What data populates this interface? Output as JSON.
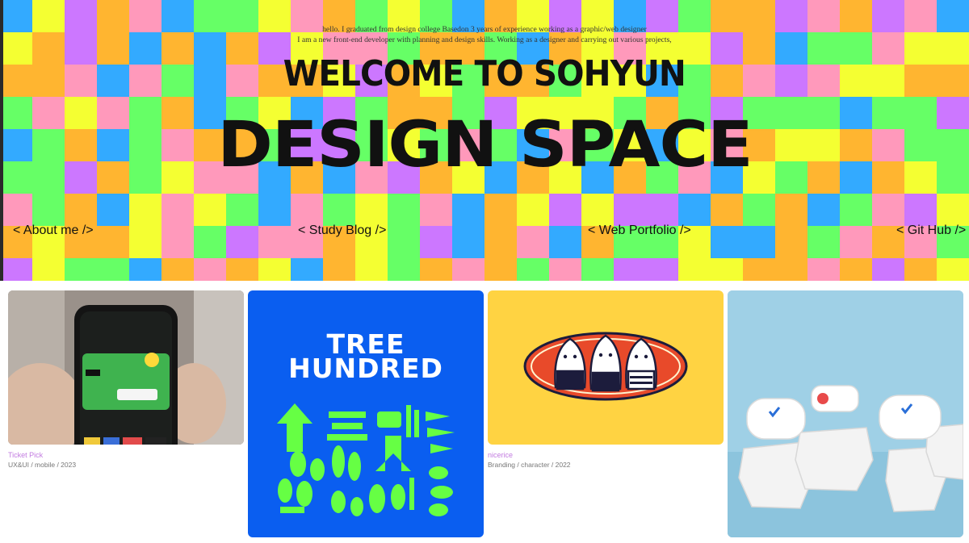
{
  "hero": {
    "intro_line1": "hello. I graduated from design college Basedon 3 years of experience working as a graphic/web designer",
    "intro_line2": "I am a new front-end developer with planning and design skills. Working as a designer and carrying out various projects,",
    "title_line1": "WELCOME TO SOHYUN",
    "title_line2": "DESIGN SPACE",
    "palette": {
      "yellow": "#f4ff32",
      "green": "#66ff66",
      "purple": "#cc77ff",
      "orange": "#ffb530",
      "pink": "#ff99bb",
      "blue": "#33aaff"
    }
  },
  "nav": [
    {
      "label": "< About me />"
    },
    {
      "label": "< Study Blog />"
    },
    {
      "label": "< Web Portfolio />"
    },
    {
      "label": "< Git Hub />"
    }
  ],
  "projects": [
    {
      "name": "Ticket Pick",
      "meta": "UX&UI / mobile / 2023"
    },
    {
      "name": "",
      "meta": "",
      "thumb_title_line1": "TREE",
      "thumb_title_line2": "HUNDRED"
    },
    {
      "name": "nicerice",
      "meta": "Branding / character / 2022"
    },
    {
      "name": "",
      "meta": ""
    }
  ]
}
